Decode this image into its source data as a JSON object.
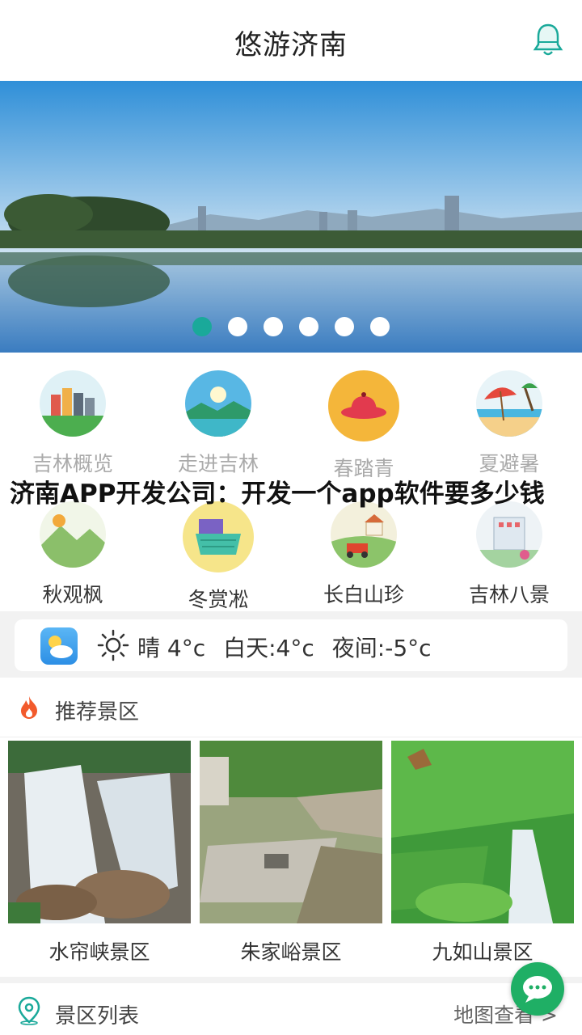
{
  "header": {
    "title": "悠游济南",
    "bell_icon": "bell-icon"
  },
  "banner": {
    "slide_count": 6,
    "active_index": 0,
    "accent": "#1aa99a"
  },
  "grid": {
    "row1": [
      {
        "label": "吉林概览",
        "icon": "city-icon"
      },
      {
        "label": "走进吉林",
        "icon": "lake-icon"
      },
      {
        "label": "春踏青",
        "icon": "hat-icon"
      },
      {
        "label": "夏避暑",
        "icon": "beach-icon"
      }
    ],
    "row2": [
      {
        "label": "秋观枫",
        "icon": "maple-icon"
      },
      {
        "label": "冬赏凇",
        "icon": "basket-icon"
      },
      {
        "label": "长白山珍",
        "icon": "farm-icon"
      },
      {
        "label": "吉林八景",
        "icon": "building-icon"
      }
    ]
  },
  "overlay_text": "济南APP开发公司：开发一个app软件要多少钱",
  "weather": {
    "condition": "晴 4°c",
    "day": "白天:4°c",
    "night": "夜间:-5°c"
  },
  "recommend": {
    "title": "推荐景区",
    "spots": [
      {
        "name": "水帘峡景区"
      },
      {
        "name": "朱家峪景区"
      },
      {
        "name": "九如山景区"
      }
    ]
  },
  "list": {
    "title": "景区列表",
    "map_link": "地图查看 >"
  }
}
